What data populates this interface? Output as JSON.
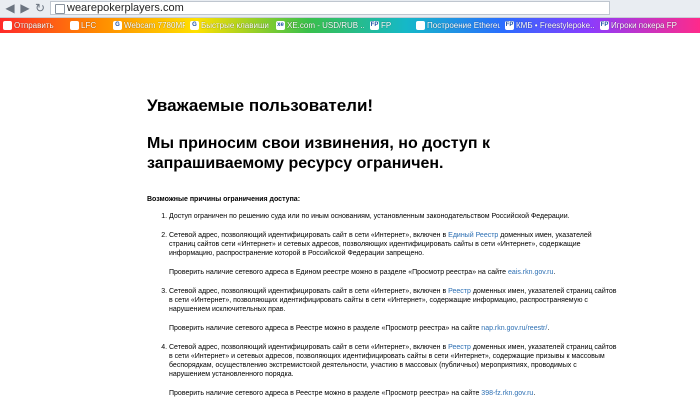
{
  "browser": {
    "url": "wearepokerplayers.com",
    "bookmarks": [
      {
        "label": "Отправить",
        "icon": ""
      },
      {
        "label": "LFC",
        "icon": ""
      },
      {
        "label": "Webcam 7780MP ...",
        "icon": "G"
      },
      {
        "label": "Быстрые клавиши ...",
        "icon": "G"
      },
      {
        "label": "XE.com - USD/RUB ...",
        "icon": "xe"
      },
      {
        "label": "FP",
        "icon": "FP"
      },
      {
        "label": "Построение Ethereum...",
        "icon": ""
      },
      {
        "label": "КМБ • Freestylepoke...",
        "icon": "FP"
      },
      {
        "label": "Игроки покера FP",
        "icon": "FP"
      }
    ]
  },
  "page": {
    "greeting": "Уважаемые пользователи!",
    "apology": "Мы приносим свои извинения, но доступ к запрашиваемому ресурсу ограничен.",
    "reasons_title": "Возможные причины ограничения доступа:",
    "reasons": [
      {
        "text": "Доступ ограничен по решению суда или по иным основаниям, установленным законодательством Российской Федерации."
      },
      {
        "text_before": "Сетевой адрес, позволяющий идентифицировать сайт в сети «Интернет», включен в ",
        "link": "Единый Реестр",
        "text_after": " доменных имен, указателей страниц сайтов сети «Интернет» и сетевых адресов, позволяющих идентифицировать сайты в сети «Интернет», содержащие информацию, распространение которой в Российской Федерации запрещено.",
        "check_text": "Проверить наличие сетевого адреса в Едином реестре можно в разделе «Просмотр реестра» на сайте ",
        "check_link": "eais.rkn.gov.ru",
        "check_end": "."
      },
      {
        "text_before": "Сетевой адрес, позволяющий идентифицировать сайт в сети «Интернет», включен в ",
        "link": "Реестр",
        "text_after": " доменных имен, указателей страниц сайтов в сети «Интернет», позволяющих идентифицировать сайты в сети «Интернет», содержащие информацию, распространяемую с нарушением исключительных прав.",
        "check_text": "Проверить наличие сетевого адреса в Реестре можно в разделе «Просмотр реестра» на сайте ",
        "check_link": "nap.rkn.gov.ru/reestr/",
        "check_end": "."
      },
      {
        "text_before": "Сетевой адрес, позволяющий идентифицировать сайт в сети «Интернет», включен в ",
        "link": "Реестр",
        "text_after": " доменных имен, указателей страниц сайтов в сети «Интернет» и сетевых адресов, позволяющих идентифицировать сайты в сети «Интернет», содержащие призывы к массовым беспорядкам, осуществлению экстремистской деятельности, участию в массовых (публичных) мероприятиях, проводимых с нарушением установленного порядка.",
        "check_text": "Проверить наличие сетевого адреса в Реестре можно в разделе «Просмотр реестра» на сайте ",
        "check_link": "398-fz.rkn.gov.ru",
        "check_end": "."
      }
    ]
  }
}
